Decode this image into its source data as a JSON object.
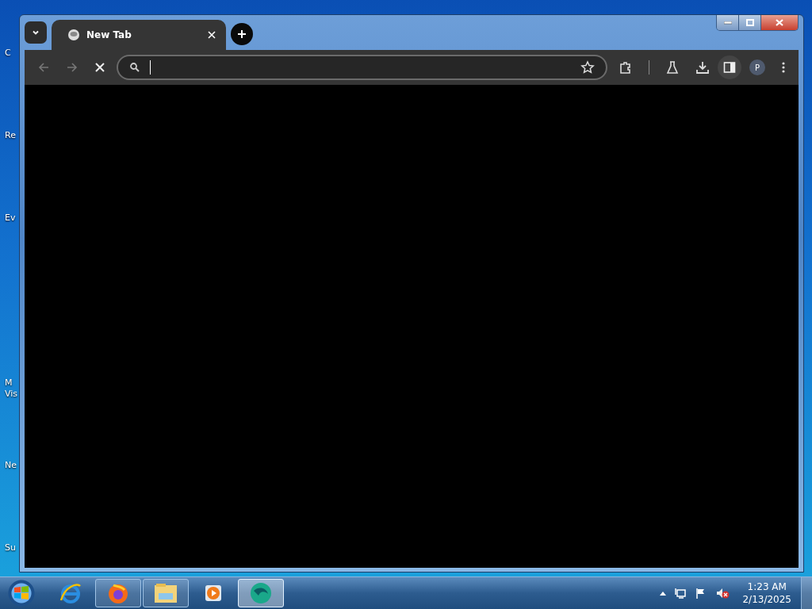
{
  "desktop": {
    "icon_labels": [
      "C",
      "Re",
      "Ev",
      "M",
      "Vis",
      "Ne",
      "Su"
    ]
  },
  "browser": {
    "tabs": [
      {
        "title": "New Tab",
        "selected": true
      }
    ],
    "loading": true,
    "profile_initial": "P"
  },
  "taskbar": {
    "apps": [
      {
        "kind": "ie",
        "running": false,
        "selected": false
      },
      {
        "kind": "firefox",
        "running": true,
        "selected": false
      },
      {
        "kind": "explorer",
        "running": true,
        "selected": false
      },
      {
        "kind": "media",
        "running": false,
        "selected": false
      },
      {
        "kind": "browser",
        "running": true,
        "selected": true
      }
    ],
    "volume_muted": true,
    "time": "1:23 AM",
    "date": "2/13/2025"
  }
}
